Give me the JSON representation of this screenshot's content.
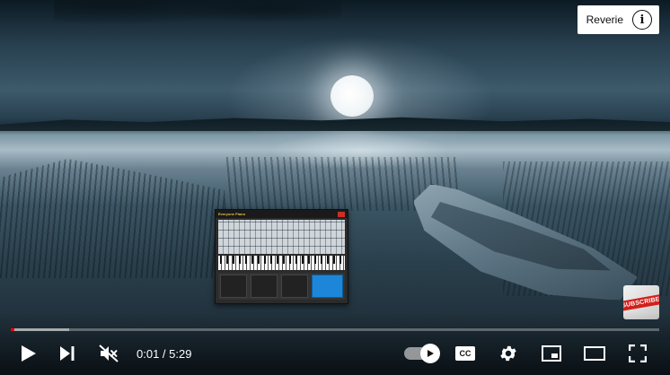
{
  "video": {
    "title": "Reverie"
  },
  "thumbnail_app": {
    "title": "Everyone Piano"
  },
  "watermark": {
    "label": "SUBSCRIBE"
  },
  "player": {
    "current_time": "0:01",
    "duration": "5:29",
    "time_separator": " / ",
    "progress_fraction": 0.003,
    "buffer_fraction": 0.09,
    "progress_color": "#ff0000"
  },
  "controls": {
    "cc_label": "CC",
    "icons": [
      "play-icon",
      "next-icon",
      "mute-icon",
      "autoplay-icon",
      "cc-icon",
      "settings-icon",
      "miniplayer-icon",
      "theater-icon",
      "fullscreen-icon"
    ]
  },
  "info_icon_glyph": "i"
}
